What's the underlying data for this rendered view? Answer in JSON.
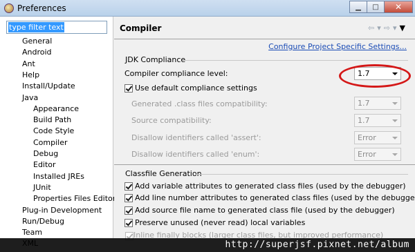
{
  "window": {
    "title": "Preferences",
    "minimize": "▁",
    "maximize": "□",
    "close": "✕"
  },
  "filter": {
    "value": "type filter text"
  },
  "tree": [
    {
      "label": "General",
      "indent": 0
    },
    {
      "label": "Android",
      "indent": 0
    },
    {
      "label": "Ant",
      "indent": 0
    },
    {
      "label": "Help",
      "indent": 0
    },
    {
      "label": "Install/Update",
      "indent": 0
    },
    {
      "label": "Java",
      "indent": 0
    },
    {
      "label": "Appearance",
      "indent": 1
    },
    {
      "label": "Build Path",
      "indent": 1
    },
    {
      "label": "Code Style",
      "indent": 1
    },
    {
      "label": "Compiler",
      "indent": 1,
      "selected": true
    },
    {
      "label": "Debug",
      "indent": 1
    },
    {
      "label": "Editor",
      "indent": 1
    },
    {
      "label": "Installed JREs",
      "indent": 1
    },
    {
      "label": "JUnit",
      "indent": 1
    },
    {
      "label": "Properties Files Editor",
      "indent": 1
    },
    {
      "label": "Plug-in Development",
      "indent": 0
    },
    {
      "label": "Run/Debug",
      "indent": 0
    },
    {
      "label": "Team",
      "indent": 0
    },
    {
      "label": "XML",
      "indent": 0
    }
  ],
  "page": {
    "title": "Compiler",
    "configure_link": "Configure Project Specific Settings...",
    "nav": {
      "back_icon": "⇦",
      "back_dropdown": "▾",
      "forward_icon": "⇨",
      "forward_dropdown": "▾",
      "menu_icon": "▼"
    }
  },
  "jdk": {
    "group_title": "JDK Compliance",
    "compliance_label": "Compiler compliance level:",
    "compliance_value": "1.7",
    "use_default_label": "Use default compliance settings",
    "use_default_checked": true,
    "generated_label": "Generated .class files compatibility:",
    "generated_value": "1.7",
    "source_label": "Source compatibility:",
    "source_value": "1.7",
    "assert_label": "Disallow identifiers called 'assert':",
    "assert_value": "Error",
    "enum_label": "Disallow identifiers called 'enum':",
    "enum_value": "Error"
  },
  "classfile": {
    "group_title": "Classfile Generation",
    "options": [
      {
        "label": "Add variable attributes to generated class files (used by the debugger)",
        "checked": true
      },
      {
        "label": "Add line number attributes to generated class files (used by the debugger)",
        "checked": true
      },
      {
        "label": "Add source file name to generated class file (used by the debugger)",
        "checked": true
      },
      {
        "label": "Preserve unused (never read) local variables",
        "checked": true
      }
    ],
    "partial_option": "Inline finally blocks (larger class files, but improved performance)"
  },
  "watermark": {
    "text": "http://superjsf.pixnet.net/album"
  },
  "colors": {
    "link": "#1a4bb5",
    "highlight": "#d41818",
    "selection": "#3399ff"
  }
}
